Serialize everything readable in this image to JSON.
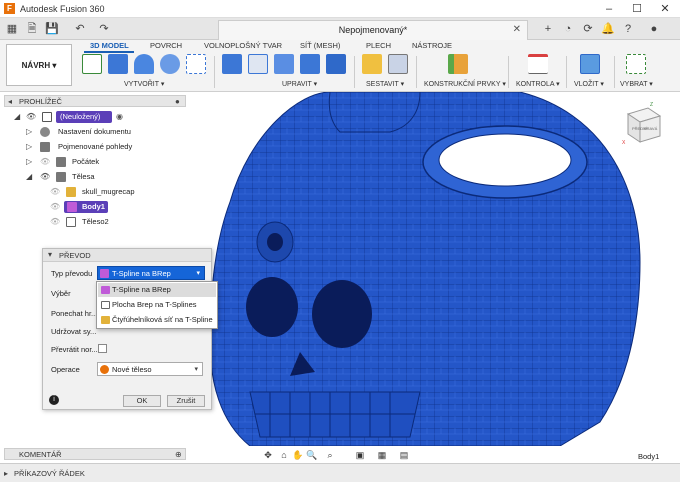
{
  "window": {
    "title": "Autodesk Fusion 360",
    "logo": "F",
    "minimize": "–",
    "maximize": "☐",
    "close": "✕"
  },
  "tabbar": {
    "doc_title": "Nepojmenovaný*",
    "doc_close": "✕"
  },
  "ribbon": {
    "workspace": "NÁVRH ▾",
    "tabs": [
      "3D MODEL",
      "POVRCH",
      "VOLNOPLOŠNÝ TVAR",
      "SÍŤ (MESH)",
      "PLECH",
      "NÁSTROJE"
    ],
    "groups": [
      "VYTVOŘIT ▾",
      "UPRAVIT ▾",
      "SESTAVIT ▾",
      "KONSTRUKČNÍ PRVKY ▾",
      "KONTROLA ▾",
      "VLOŽIT ▾",
      "VYBRAT ▾"
    ]
  },
  "browser": {
    "header": "PROHLÍŽEČ",
    "items": [
      {
        "label": "(Neuložený)"
      },
      {
        "label": "Nastavení dokumentu"
      },
      {
        "label": "Pojmenované pohledy"
      },
      {
        "label": "Počátek"
      },
      {
        "label": "Tělesa"
      },
      {
        "label": "skull_mugrecap"
      },
      {
        "label": "Body1"
      },
      {
        "label": "Těleso2"
      }
    ]
  },
  "viewcube": {
    "front": "PŘEDNÍ",
    "right": "PRAVÁ",
    "axis_z": "Z",
    "axis_x": "X"
  },
  "dialog": {
    "title": "PŘEVOD",
    "rows": {
      "type_label": "Typ převodu",
      "type_value": "T-Spline na BRep",
      "selection_label": "Výběr",
      "keep_label": "Ponechat hr...",
      "maintain_label": "Udržovat sy...",
      "flip_label": "Převrátit nor...",
      "operation_label": "Operace",
      "operation_value": "Nové těleso"
    },
    "info_icon": "i",
    "ok": "OK",
    "cancel": "Zrušit",
    "dropdown_options": [
      "T-Spline na BRep",
      "Plocha Brep na T-Splines",
      "Čtyřúhelníková síť na T-Spline"
    ]
  },
  "status": {
    "comments": "KOMENTÁŘ",
    "command_line": "PŘÍKAZOVÝ ŘÁDEK",
    "selected_body": "Body1"
  },
  "colors": {
    "model_blue": "#2456c8",
    "accent_blue": "#1a5fb4",
    "selection_blue": "#1565d8",
    "highlight_purple": "#5b3fb8"
  }
}
